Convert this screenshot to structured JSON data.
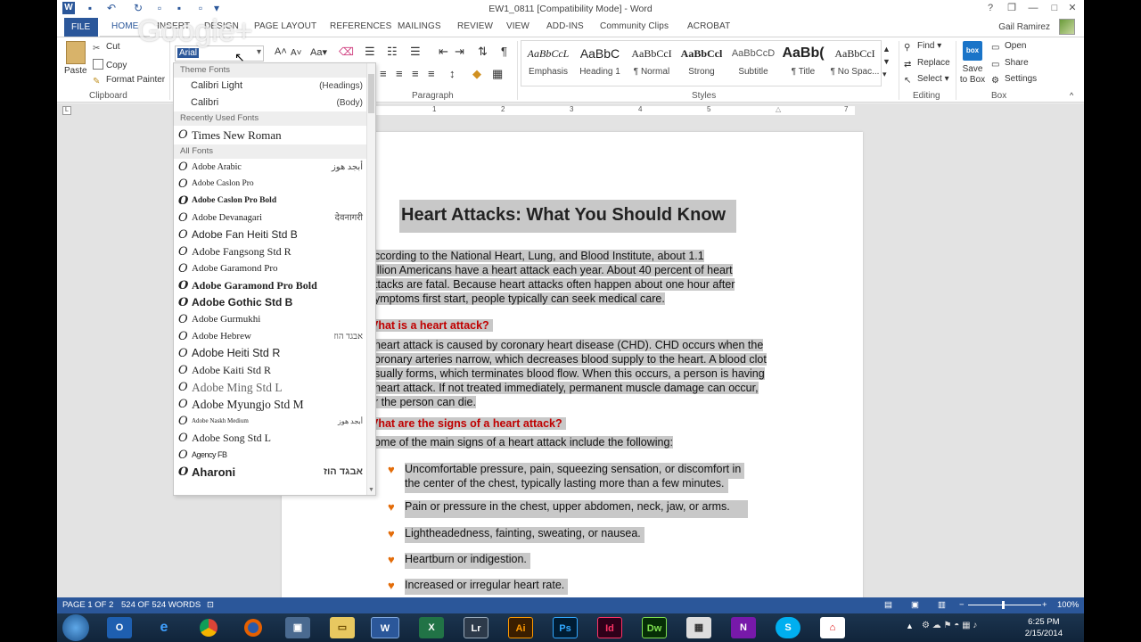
{
  "title_bar": {
    "document_title": "EW1_0811 [Compatibility Mode] - Word",
    "help": "?",
    "restore": "❐",
    "minimize": "—",
    "maximize": "□",
    "close": "✕"
  },
  "tabs": [
    "FILE",
    "HOME",
    "INSERT",
    "DESIGN",
    "PAGE LAYOUT",
    "REFERENCES",
    "MAILINGS",
    "REVIEW",
    "VIEW",
    "ADD-INS",
    "Community Clips",
    "ACROBAT"
  ],
  "user": {
    "name": "Gail Ramirez"
  },
  "ribbon": {
    "clipboard": {
      "paste": "Paste",
      "cut": "Cut",
      "copy": "Copy",
      "format_painter": "Format Painter",
      "label": "Clipboard"
    },
    "font": {
      "current": "Arial"
    },
    "paragraph": {
      "label": "Paragraph"
    },
    "styles": {
      "label": "Styles",
      "items": [
        {
          "sample": "AaBbCcL",
          "name": "Emphasis"
        },
        {
          "sample": "AaBbC",
          "name": "Heading 1"
        },
        {
          "sample": "AaBbCcI",
          "name": "¶ Normal"
        },
        {
          "sample": "AaBbCcl",
          "name": "Strong"
        },
        {
          "sample": "AaBbCcD",
          "name": "Subtitle"
        },
        {
          "sample": "AaBb(",
          "name": "¶ Title"
        },
        {
          "sample": "AaBbCcI",
          "name": "¶ No Spac..."
        }
      ]
    },
    "editing": {
      "find": "Find",
      "replace": "Replace",
      "select": "Select",
      "label": "Editing"
    },
    "box": {
      "save": "Save to Box",
      "open": "Open",
      "share": "Share",
      "settings": "Settings",
      "label": "Box",
      "logo": "box"
    }
  },
  "font_dropdown": {
    "theme_header": "Theme Fonts",
    "theme_fonts": [
      {
        "name": "Calibri Light",
        "role": "(Headings)"
      },
      {
        "name": "Calibri",
        "role": "(Body)"
      }
    ],
    "recent_header": "Recently Used Fonts",
    "recent_fonts": [
      "Times New Roman"
    ],
    "all_header": "All Fonts",
    "all_fonts": [
      {
        "name": "Adobe Arabic",
        "sample": "أبجد هوز"
      },
      {
        "name": "Adobe Caslon Pro",
        "sample": ""
      },
      {
        "name": "Adobe Caslon Pro Bold",
        "sample": ""
      },
      {
        "name": "Adobe Devanagari",
        "sample": "देवनागरी"
      },
      {
        "name": "Adobe Fan Heiti Std B",
        "sample": ""
      },
      {
        "name": "Adobe Fangsong Std R",
        "sample": ""
      },
      {
        "name": "Adobe Garamond Pro",
        "sample": ""
      },
      {
        "name": "Adobe Garamond Pro Bold",
        "sample": ""
      },
      {
        "name": "Adobe Gothic Std B",
        "sample": ""
      },
      {
        "name": "Adobe Gurmukhi",
        "sample": ""
      },
      {
        "name": "Adobe Hebrew",
        "sample": "אבגד הוז"
      },
      {
        "name": "Adobe Heiti Std R",
        "sample": ""
      },
      {
        "name": "Adobe Kaiti Std R",
        "sample": ""
      },
      {
        "name": "Adobe Ming Std L",
        "sample": ""
      },
      {
        "name": "Adobe Myungjo Std M",
        "sample": ""
      },
      {
        "name": "Adobe Naskh Medium",
        "sample": "أبجد هوز"
      },
      {
        "name": "Adobe Song Std L",
        "sample": ""
      },
      {
        "name": "Agency FB",
        "sample": ""
      },
      {
        "name": "Aharoni",
        "sample": "אבגד הוז"
      }
    ]
  },
  "ruler": {
    "numbers": [
      "1",
      "2",
      "3",
      "4",
      "5",
      "6",
      "7"
    ]
  },
  "document": {
    "title": "Heart Attacks: What You Should Know",
    "intro_lines": [
      "ccording to the National Heart, Lung, and Blood Institute, about 1.1",
      "illion Americans have a heart attack each year. About 40 percent of heart",
      "ttacks are fatal. Because heart attacks often happen about one hour after",
      "ymptoms first start, people typically can seek medical care."
    ],
    "h2_1": "Vhat is a heart attack?",
    "p2_lines": [
      " heart attack is caused by coronary heart disease (CHD). CHD occurs when the",
      "oronary arteries narrow, which decreases blood supply to the heart. A blood clot",
      "sually forms, which terminates blood flow. When this occurs, a person is having",
      " heart attack. If not treated immediately, permanent muscle damage can occur,",
      "r the person can die."
    ],
    "h2_2": "Vhat are the signs of a heart attack?",
    "p3": "ome of the main signs of a heart attack include the following:",
    "bullets": [
      [
        "Uncomfortable pressure, pain, squeezing sensation, or discomfort in",
        "the center of the chest, typically lasting more than a few minutes."
      ],
      [
        "Pain or pressure in the chest, upper abdomen, neck, jaw, or arms."
      ],
      [
        "Lightheadedness, fainting, sweating, or nausea."
      ],
      [
        "Heartburn or indigestion."
      ],
      [
        "Increased or irregular heart rate."
      ]
    ]
  },
  "status_bar": {
    "page": "PAGE 1 OF 2",
    "words": "524 OF 524 WORDS",
    "zoom": "100%"
  },
  "taskbar": {
    "apps": [
      "Ie",
      "Chrome",
      "Firefox",
      "Explorer",
      "Word",
      "Excel",
      "Lr",
      "Ai",
      "Ps",
      "Id",
      "Dw",
      "Calc",
      "OneNote",
      "Skype",
      "PDF"
    ],
    "time": "6:25 PM",
    "date": "2/15/2014"
  },
  "overlay": {
    "watermark": "Google+"
  }
}
